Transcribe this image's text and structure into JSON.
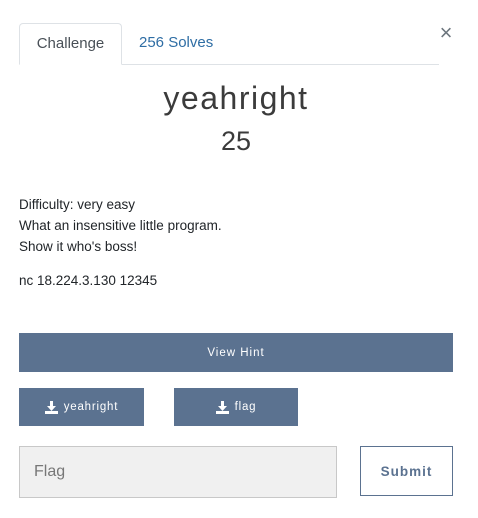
{
  "tabs": {
    "challenge_label": "Challenge",
    "solves_label": "256 Solves"
  },
  "close_label": "×",
  "challenge": {
    "name": "yeahright",
    "value": "25",
    "description_lines": [
      "Difficulty: very easy",
      "What an insensitive little program.",
      "Show it who's boss!"
    ],
    "connection": "nc 18.224.3.130 12345"
  },
  "hint_button_label": "View Hint",
  "files": [
    {
      "label": "yeahright",
      "icon": "download-icon"
    },
    {
      "label": "flag",
      "icon": "download-icon"
    }
  ],
  "flag_input": {
    "placeholder": "Flag",
    "value": ""
  },
  "submit_label": "Submit",
  "colors": {
    "primary": "#5b7290",
    "link": "#2e6da4",
    "input_bg": "#f0f0f0"
  }
}
